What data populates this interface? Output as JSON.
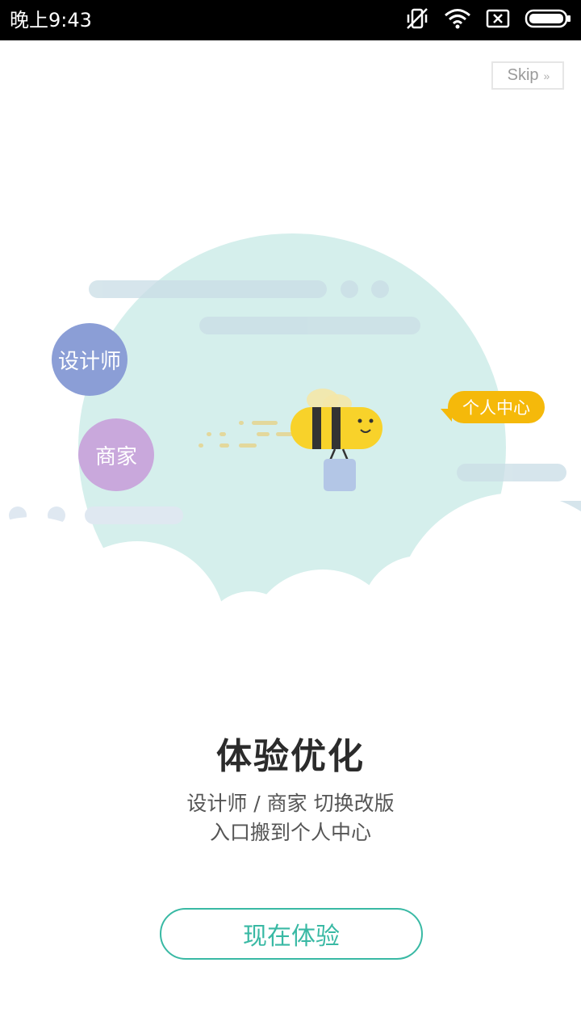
{
  "status_bar": {
    "time": "晚上9:43",
    "icons": [
      "vibrate-off-icon",
      "wifi-icon",
      "sim-off-icon",
      "battery-icon"
    ]
  },
  "skip": {
    "label": "Skip",
    "arrows": "»"
  },
  "illustration": {
    "designer_label": "设计师",
    "merchant_label": "商家",
    "personal_center_label": "个人中心",
    "colors": {
      "globe": "#d5efec",
      "cloud": "#e8eef6",
      "designer": "#8b9ed6",
      "merchant": "#c9a8dc",
      "tag": "#f5b90a",
      "bee": "#f8d22a"
    }
  },
  "content": {
    "title": "体验优化",
    "desc_line1": "设计师 / 商家 切换改版",
    "desc_line2": "入口搬到个人中心"
  },
  "cta": {
    "label": "现在体验",
    "accent": "#39b9a4"
  }
}
